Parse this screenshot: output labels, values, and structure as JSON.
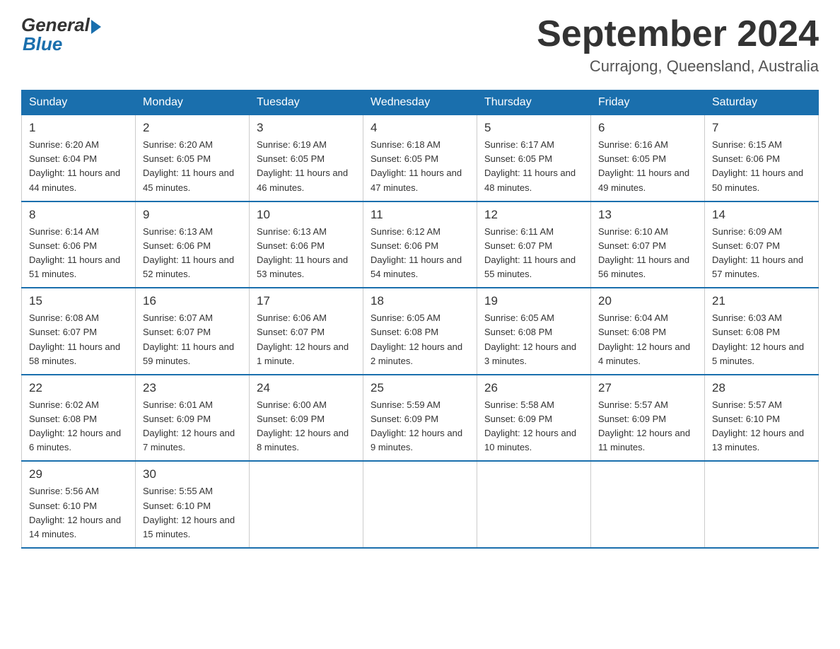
{
  "logo": {
    "general": "General",
    "blue": "Blue"
  },
  "title": "September 2024",
  "subtitle": "Currajong, Queensland, Australia",
  "weekdays": [
    "Sunday",
    "Monday",
    "Tuesday",
    "Wednesday",
    "Thursday",
    "Friday",
    "Saturday"
  ],
  "weeks": [
    [
      {
        "day": "1",
        "sunrise": "6:20 AM",
        "sunset": "6:04 PM",
        "daylight": "11 hours and 44 minutes."
      },
      {
        "day": "2",
        "sunrise": "6:20 AM",
        "sunset": "6:05 PM",
        "daylight": "11 hours and 45 minutes."
      },
      {
        "day": "3",
        "sunrise": "6:19 AM",
        "sunset": "6:05 PM",
        "daylight": "11 hours and 46 minutes."
      },
      {
        "day": "4",
        "sunrise": "6:18 AM",
        "sunset": "6:05 PM",
        "daylight": "11 hours and 47 minutes."
      },
      {
        "day": "5",
        "sunrise": "6:17 AM",
        "sunset": "6:05 PM",
        "daylight": "11 hours and 48 minutes."
      },
      {
        "day": "6",
        "sunrise": "6:16 AM",
        "sunset": "6:05 PM",
        "daylight": "11 hours and 49 minutes."
      },
      {
        "day": "7",
        "sunrise": "6:15 AM",
        "sunset": "6:06 PM",
        "daylight": "11 hours and 50 minutes."
      }
    ],
    [
      {
        "day": "8",
        "sunrise": "6:14 AM",
        "sunset": "6:06 PM",
        "daylight": "11 hours and 51 minutes."
      },
      {
        "day": "9",
        "sunrise": "6:13 AM",
        "sunset": "6:06 PM",
        "daylight": "11 hours and 52 minutes."
      },
      {
        "day": "10",
        "sunrise": "6:13 AM",
        "sunset": "6:06 PM",
        "daylight": "11 hours and 53 minutes."
      },
      {
        "day": "11",
        "sunrise": "6:12 AM",
        "sunset": "6:06 PM",
        "daylight": "11 hours and 54 minutes."
      },
      {
        "day": "12",
        "sunrise": "6:11 AM",
        "sunset": "6:07 PM",
        "daylight": "11 hours and 55 minutes."
      },
      {
        "day": "13",
        "sunrise": "6:10 AM",
        "sunset": "6:07 PM",
        "daylight": "11 hours and 56 minutes."
      },
      {
        "day": "14",
        "sunrise": "6:09 AM",
        "sunset": "6:07 PM",
        "daylight": "11 hours and 57 minutes."
      }
    ],
    [
      {
        "day": "15",
        "sunrise": "6:08 AM",
        "sunset": "6:07 PM",
        "daylight": "11 hours and 58 minutes."
      },
      {
        "day": "16",
        "sunrise": "6:07 AM",
        "sunset": "6:07 PM",
        "daylight": "11 hours and 59 minutes."
      },
      {
        "day": "17",
        "sunrise": "6:06 AM",
        "sunset": "6:07 PM",
        "daylight": "12 hours and 1 minute."
      },
      {
        "day": "18",
        "sunrise": "6:05 AM",
        "sunset": "6:08 PM",
        "daylight": "12 hours and 2 minutes."
      },
      {
        "day": "19",
        "sunrise": "6:05 AM",
        "sunset": "6:08 PM",
        "daylight": "12 hours and 3 minutes."
      },
      {
        "day": "20",
        "sunrise": "6:04 AM",
        "sunset": "6:08 PM",
        "daylight": "12 hours and 4 minutes."
      },
      {
        "day": "21",
        "sunrise": "6:03 AM",
        "sunset": "6:08 PM",
        "daylight": "12 hours and 5 minutes."
      }
    ],
    [
      {
        "day": "22",
        "sunrise": "6:02 AM",
        "sunset": "6:08 PM",
        "daylight": "12 hours and 6 minutes."
      },
      {
        "day": "23",
        "sunrise": "6:01 AM",
        "sunset": "6:09 PM",
        "daylight": "12 hours and 7 minutes."
      },
      {
        "day": "24",
        "sunrise": "6:00 AM",
        "sunset": "6:09 PM",
        "daylight": "12 hours and 8 minutes."
      },
      {
        "day": "25",
        "sunrise": "5:59 AM",
        "sunset": "6:09 PM",
        "daylight": "12 hours and 9 minutes."
      },
      {
        "day": "26",
        "sunrise": "5:58 AM",
        "sunset": "6:09 PM",
        "daylight": "12 hours and 10 minutes."
      },
      {
        "day": "27",
        "sunrise": "5:57 AM",
        "sunset": "6:09 PM",
        "daylight": "12 hours and 11 minutes."
      },
      {
        "day": "28",
        "sunrise": "5:57 AM",
        "sunset": "6:10 PM",
        "daylight": "12 hours and 13 minutes."
      }
    ],
    [
      {
        "day": "29",
        "sunrise": "5:56 AM",
        "sunset": "6:10 PM",
        "daylight": "12 hours and 14 minutes."
      },
      {
        "day": "30",
        "sunrise": "5:55 AM",
        "sunset": "6:10 PM",
        "daylight": "12 hours and 15 minutes."
      },
      null,
      null,
      null,
      null,
      null
    ]
  ],
  "labels": {
    "sunrise": "Sunrise:",
    "sunset": "Sunset:",
    "daylight": "Daylight:"
  }
}
